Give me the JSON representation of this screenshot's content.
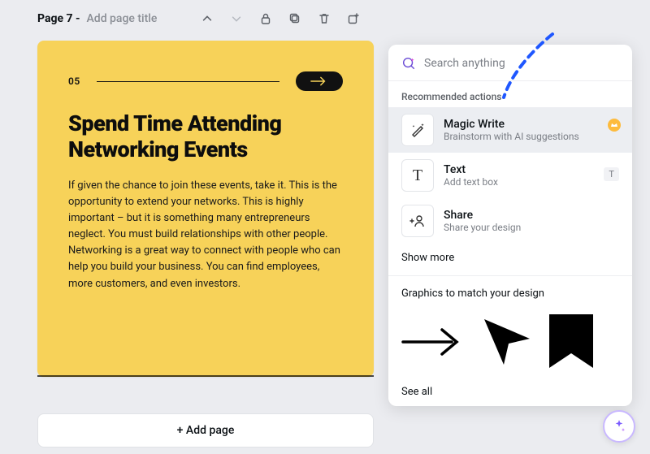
{
  "toolbar": {
    "page_label": "Page 7 -",
    "title_placeholder": "Add page title"
  },
  "slide": {
    "number": "05",
    "title": "Spend Time Attending Networking Events",
    "body": "If given the chance to join these events, take it. This is the opportunity to extend your networks. This is highly important – but it is something many entrepreneurs neglect. You must build relationships with other people. Networking is a great way to connect with people who can help you build your business. You can find employees, more customers, and even investors."
  },
  "add_page_label": "+ Add page",
  "panel": {
    "search_placeholder": "Search anything",
    "recommended_label": "Recommended actions",
    "actions": [
      {
        "title": "Magic Write",
        "sub": "Brainstorm with AI suggestions",
        "shortcut": ""
      },
      {
        "title": "Text",
        "sub": "Add text box",
        "shortcut": "T"
      },
      {
        "title": "Share",
        "sub": "Share your design",
        "shortcut": ""
      }
    ],
    "show_more": "Show more",
    "graphics_label": "Graphics to match your design",
    "see_all": "See all"
  }
}
